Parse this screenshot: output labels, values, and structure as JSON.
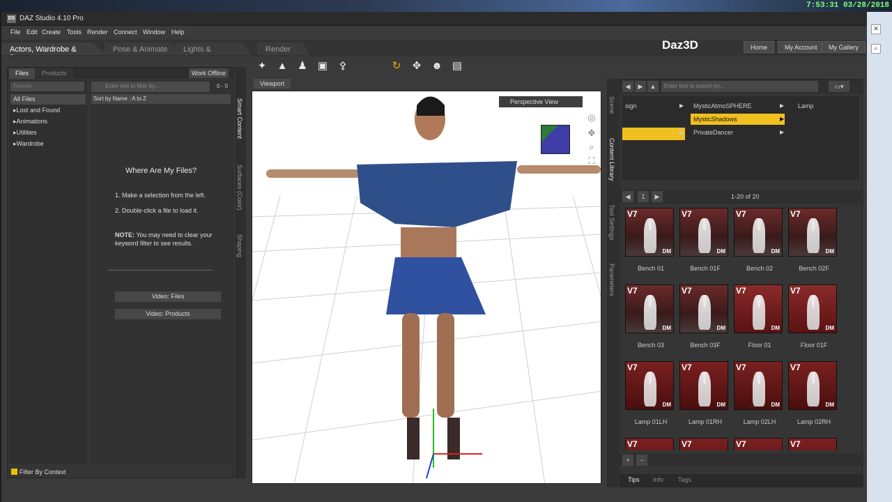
{
  "clock": "7:53:31  03/28/2018",
  "window": {
    "title": "DAZ Studio 4.10 Pro",
    "icon_text": "DS"
  },
  "menu": [
    "File",
    "Edit",
    "Create",
    "Tools",
    "Render",
    "Connect",
    "Window",
    "Help"
  ],
  "rooms": [
    "Actors, Wardrobe & Props",
    "Pose & Animate",
    "Lights & Cameras",
    "Render"
  ],
  "brand": {
    "logo": "Daz3D",
    "buttons": [
      "Home",
      "My Account",
      "My Gallery"
    ]
  },
  "left": {
    "tabs": [
      "Files",
      "Products"
    ],
    "work_offline": "Work Offline",
    "filter_placeholder": "Female",
    "categories": [
      "All Files",
      "Lost and Found",
      "Animations",
      "Utilities",
      "Wardrobe"
    ],
    "search_placeholder": "Enter text to filter by...",
    "count": "0 - 0",
    "sort": "Sort by Name : A to Z",
    "heading": "Where Are My Files?",
    "step1": "1. Make a selection from the left.",
    "step2": "2. Double-click a file to load it.",
    "note_label": "NOTE:",
    "note_text": " You may need to clear your keyword filter to see results.",
    "video_files": "Video: Files",
    "video_products": "Video:  Products",
    "filter_context": "Filter By Context"
  },
  "side_tabs_left": [
    "Smart Content",
    "Surfaces (Color)",
    "Shaping"
  ],
  "side_tabs_right": [
    "Scene",
    "Content Library",
    "Tool Settings",
    "Parameters"
  ],
  "viewport": {
    "tab": "Viewport",
    "camera": "Perspective View"
  },
  "library": {
    "search_placeholder": "Enter text to search by...",
    "col1": [
      "sign",
      ""
    ],
    "col2": [
      "MysticAtmoSPHERE",
      "MysticShadows",
      "PrivateDancer"
    ],
    "col3": [
      "Lamp"
    ],
    "page": "1",
    "range": "1-20 of 20",
    "items": [
      "Bench 01",
      "Bench 01F",
      "Bench 02",
      "Bench 02F",
      "Bench 03",
      "Bench 03F",
      "Floor 01",
      "Floor 01F",
      "Lamp 01LH",
      "Lamp 01RH",
      "Lamp 02LH",
      "Lamp 02RH",
      "",
      "",
      "",
      ""
    ],
    "thumb_badge": "V7",
    "thumb_dm": "DM",
    "info_tabs": [
      "Tips",
      "Info",
      "Tags"
    ]
  }
}
